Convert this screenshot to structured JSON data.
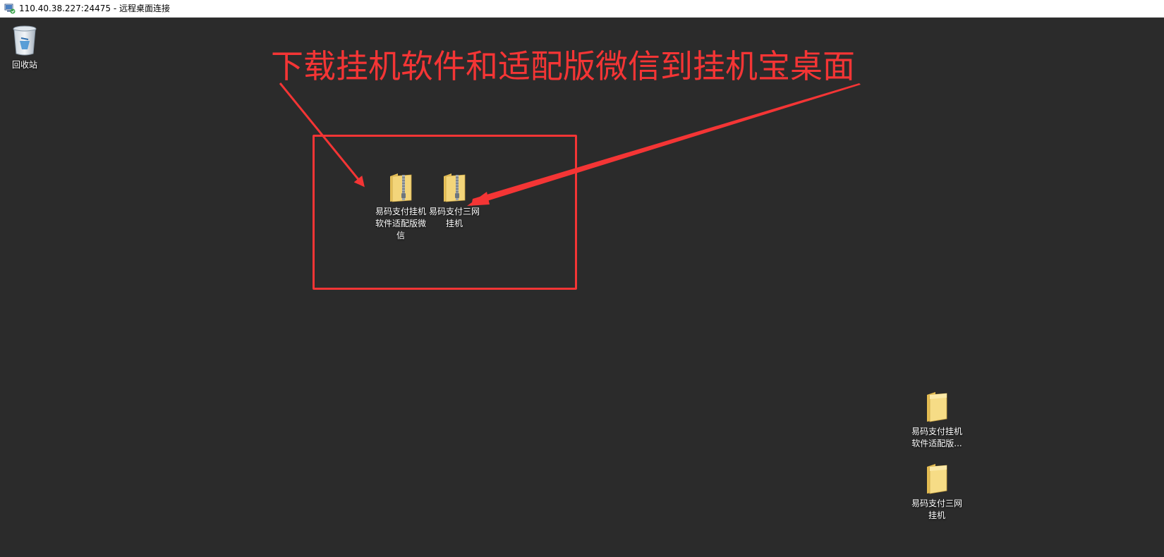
{
  "window": {
    "title": "110.40.38.227:24475 - 远程桌面连接"
  },
  "desktop": {
    "recycle_bin": {
      "label": "回收站",
      "icon": "recycle-bin-icon"
    },
    "annotation": {
      "text": "下载挂机软件和适配版微信到挂机宝桌面",
      "color": "#f43535"
    },
    "highlighted_files": [
      {
        "label": "易码支付挂机软件适配版微信",
        "icon": "zip-folder-icon"
      },
      {
        "label": "易码支付三网挂机",
        "icon": "zip-folder-icon"
      }
    ],
    "folders": [
      {
        "label": "易码支付挂机软件适配版...",
        "icon": "folder-icon"
      },
      {
        "label": "易码支付三网挂机",
        "icon": "folder-icon"
      }
    ]
  },
  "colors": {
    "desktop_background": "#2b2b2b",
    "accent_red": "#f43535",
    "folder_yellow": "#f3d57a"
  }
}
